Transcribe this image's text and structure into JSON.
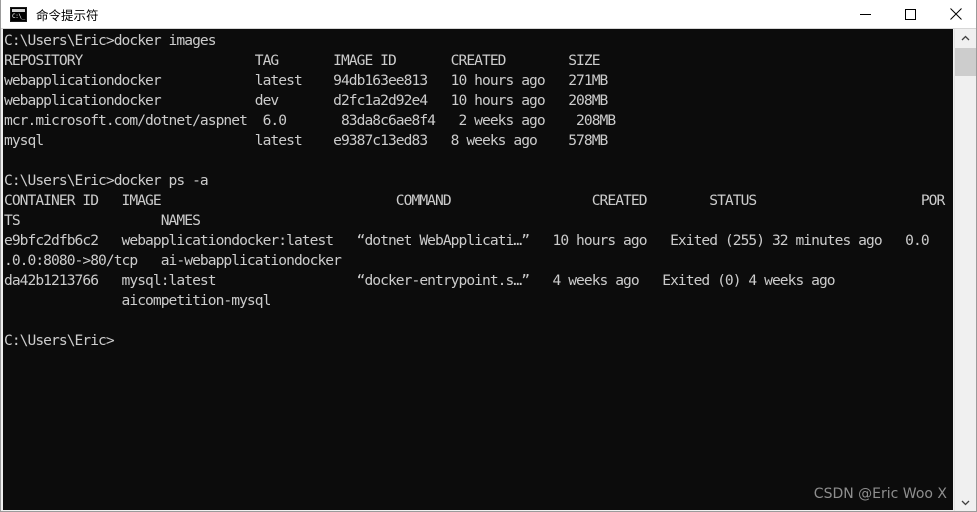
{
  "window": {
    "title": "命令提示符",
    "icon": "cmd-icon",
    "controls": {
      "minimize": "minimize-icon",
      "maximize": "maximize-icon",
      "close": "close-icon"
    }
  },
  "console": {
    "background_color": "#0c0c0c",
    "foreground_color": "#cccccc",
    "lines": [
      "C:\\Users\\Eric>docker images",
      "REPOSITORY                      TAG       IMAGE ID       CREATED        SIZE",
      "webapplicationdocker            latest    94db163ee813   10 hours ago   271MB",
      "webapplicationdocker            dev       d2fc1a2d92e4   10 hours ago   208MB",
      "mcr.microsoft.com/dotnet/aspnet  6.0       83da8c6ae8f4   2 weeks ago    208MB",
      "mysql                           latest    e9387c13ed83   8 weeks ago    578MB",
      "",
      "C:\\Users\\Eric>docker ps -a",
      "CONTAINER ID   IMAGE                              COMMAND                  CREATED        STATUS                     POR",
      "TS                  NAMES",
      "e9bfc2dfb6c2   webapplicationdocker:latest   “dotnet WebApplicati…”   10 hours ago   Exited (255) 32 minutes ago   0.0",
      ".0.0:8080->80/tcp   ai-webapplicationdocker",
      "da42b1213766   mysql:latest                  “docker-entrypoint.s…”   4 weeks ago   Exited (0) 4 weeks ago",
      "               aicompetition-mysql",
      "",
      "C:\\Users\\Eric>"
    ],
    "commands": [
      "docker images",
      "docker ps -a"
    ],
    "prompt": "C:\\Users\\Eric>",
    "images_table": {
      "headers": [
        "REPOSITORY",
        "TAG",
        "IMAGE ID",
        "CREATED",
        "SIZE"
      ],
      "rows": [
        [
          "webapplicationdocker",
          "latest",
          "94db163ee813",
          "10 hours ago",
          "271MB"
        ],
        [
          "webapplicationdocker",
          "dev",
          "d2fc1a2d92e4",
          "10 hours ago",
          "208MB"
        ],
        [
          "mcr.microsoft.com/dotnet/aspnet",
          "6.0",
          "83da8c6ae8f4",
          "2 weeks ago",
          "208MB"
        ],
        [
          "mysql",
          "latest",
          "e9387c13ed83",
          "8 weeks ago",
          "578MB"
        ]
      ]
    },
    "ps_table": {
      "headers": [
        "CONTAINER ID",
        "IMAGE",
        "COMMAND",
        "CREATED",
        "STATUS",
        "PORTS",
        "NAMES"
      ],
      "rows": [
        [
          "e9bfc2dfb6c2",
          "webapplicationdocker:latest",
          "“dotnet WebApplicati…”",
          "10 hours ago",
          "Exited (255) 32 minutes ago",
          "0.0.0.0:8080->80/tcp",
          "ai-webapplicationdocker"
        ],
        [
          "da42b1213766",
          "mysql:latest",
          "“docker-entrypoint.s…”",
          "4 weeks ago",
          "Exited (0) 4 weeks ago",
          "",
          "aicompetition-mysql"
        ]
      ]
    }
  },
  "watermark": {
    "text": "CSDN @Eric Woo X"
  },
  "scrollbar": {
    "up_arrow": "chevron-up-icon",
    "down_arrow": "chevron-down-icon"
  }
}
